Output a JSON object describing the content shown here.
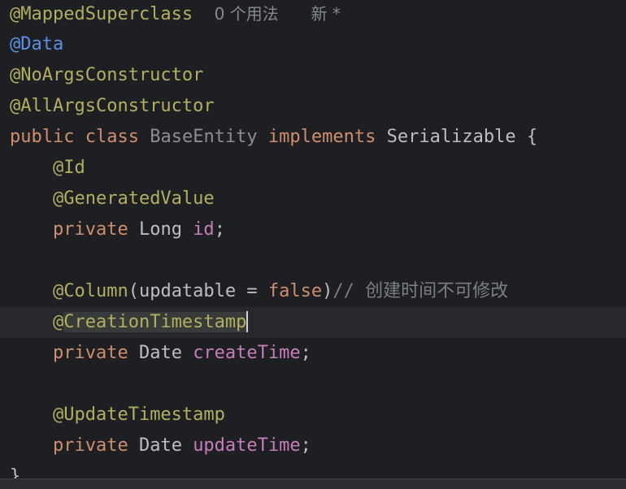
{
  "editor": {
    "lines": {
      "l1": {
        "annotation": "@MappedSuperclass",
        "hint_usages": "0 个用法",
        "hint_new": "新 *"
      },
      "l2": {
        "annotation": "@Data"
      },
      "l3": {
        "annotation": "@NoArgsConstructor"
      },
      "l4": {
        "annotation": "@AllArgsConstructor"
      },
      "l5": {
        "kw_public": "public",
        "kw_class": "class",
        "class_name": "BaseEntity",
        "kw_implements": "implements",
        "interface_name": "Serializable",
        "brace": "{"
      },
      "l6": {
        "annotation": "@Id"
      },
      "l7": {
        "annotation": "@GeneratedValue"
      },
      "l8": {
        "kw_private": "private",
        "type": "Long",
        "field": "id",
        "semicolon": ";"
      },
      "l10": {
        "annotation": "@Column",
        "open_paren": "(",
        "param": "updatable",
        "equals": " = ",
        "value": "false",
        "close_paren": ")",
        "comment": "// 创建时间不可修改"
      },
      "l11": {
        "annotation": "@CreationTimestamp"
      },
      "l12": {
        "kw_private": "private",
        "type": "Date",
        "field": "createTime",
        "semicolon": ";"
      },
      "l14": {
        "annotation": "@UpdateTimestamp"
      },
      "l15": {
        "kw_private": "private",
        "type": "Date",
        "field": "updateTime",
        "semicolon": ";"
      },
      "l16": {
        "brace": "}"
      }
    }
  },
  "colors": {
    "background": "#1e1f22",
    "annotation": "#b3ae60",
    "keyword": "#cf8e6d",
    "field": "#c77dbb",
    "text": "#bcbec4",
    "comment": "#7a7e85"
  }
}
